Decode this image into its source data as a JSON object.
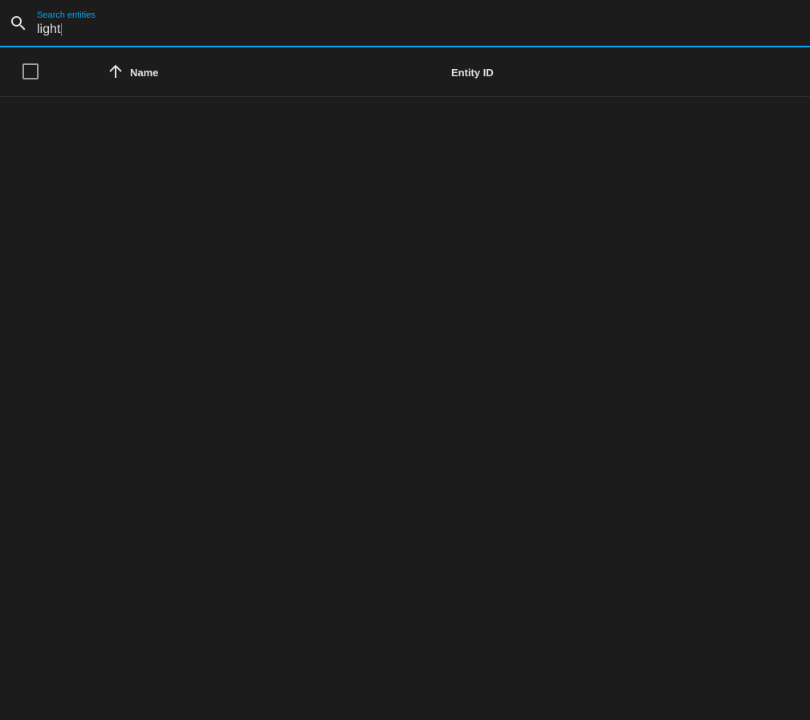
{
  "search": {
    "label": "Search entities",
    "value": "light",
    "accent_color": "#03a9f4",
    "icon": "search-icon"
  },
  "table": {
    "select_all": {
      "checked": false
    },
    "columns": [
      {
        "label": "Name",
        "sort": "ascending",
        "sort_icon": "arrow-up-icon"
      },
      {
        "label": "Entity ID"
      }
    ],
    "rows": []
  }
}
